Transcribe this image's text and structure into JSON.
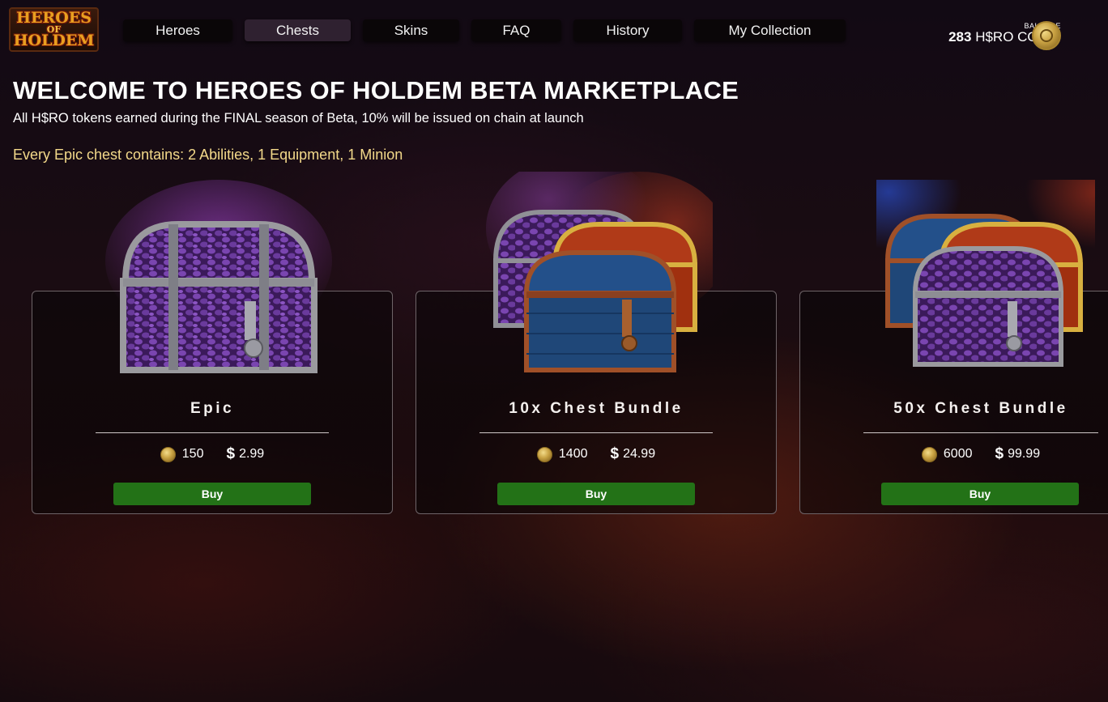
{
  "header": {
    "logo_lines": [
      "HEROES",
      "OF",
      "HOLDEM"
    ],
    "nav": [
      {
        "label": "Heroes",
        "active": false
      },
      {
        "label": "Chests",
        "active": true
      },
      {
        "label": "Skins",
        "active": false
      },
      {
        "label": "FAQ",
        "active": false
      },
      {
        "label": "History",
        "active": false
      },
      {
        "label": "My Collection",
        "active": false
      }
    ],
    "balance_label": "BALANCE",
    "balance_amount": "283",
    "balance_unit": "H$RO COINS",
    "coin_icon": "hero-coin-icon"
  },
  "main": {
    "title": "WELCOME TO HEROES OF HOLDEM BETA MARKETPLACE",
    "subtitle": "All H$RO tokens earned during the FINAL season of Beta, 10% will be issued on chain at launch",
    "note": "Every Epic chest contains: 2 Abilities, 1 Equipment, 1 Minion"
  },
  "cards": [
    {
      "name": "Epic",
      "coin_price": "150",
      "currency_symbol": "$",
      "usd_price": "2.99",
      "buy_label": "Buy"
    },
    {
      "name": "10x Chest Bundle",
      "coin_price": "1400",
      "currency_symbol": "$",
      "usd_price": "24.99",
      "buy_label": "Buy"
    },
    {
      "name": "50x Chest Bundle",
      "coin_price": "6000",
      "currency_symbol": "$",
      "usd_price": "99.99",
      "buy_label": "Buy"
    }
  ],
  "colors": {
    "accent_text": "#f3d98a",
    "buy_button": "#237217",
    "nav_active": "#2f2130"
  }
}
